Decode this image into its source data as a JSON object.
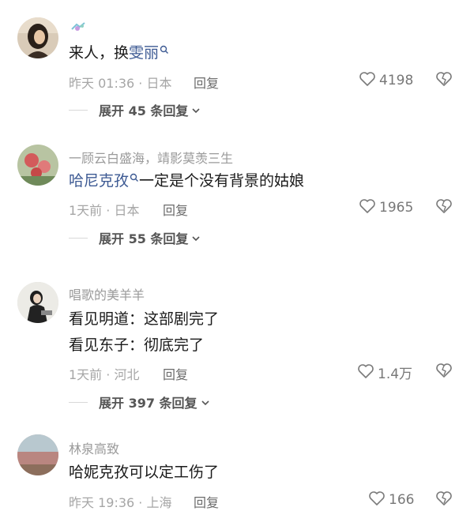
{
  "comments": [
    {
      "username": "",
      "avatar": "avatar-woman-dark-hair",
      "badge": "badge-icon",
      "mention": "雯丽",
      "text_before": "来人，换",
      "text_after": "",
      "meta": "昨天 01:36 · 日本",
      "reply": "回复",
      "likes": "4198",
      "expand": "展开 45 条回复"
    },
    {
      "username": "一顾云白盛海，靖影莫羡三生",
      "avatar": "avatar-flowers",
      "mention": "哈尼克孜",
      "text_before": "",
      "text_after": "一定是个没有背景的姑娘",
      "meta": "1天前 · 日本",
      "reply": "回复",
      "likes": "1965",
      "expand": "展开 55 条回复"
    },
    {
      "username": "唱歌的美羊羊",
      "avatar": "avatar-seated-figure",
      "lines": [
        "看见明道：这部剧完了",
        "看见东子：彻底完了"
      ],
      "meta": "1天前 · 河北",
      "reply": "回复",
      "likes": "1.4万",
      "expand": "展开 397 条回复"
    },
    {
      "username": "林泉高致",
      "avatar": "avatar-landscape",
      "text": "哈妮克孜可以定工伤了",
      "meta": "昨天 19:36 · 上海",
      "reply": "回复",
      "likes": "166"
    }
  ],
  "colors": {
    "mention": "#3d5a93",
    "meta": "#a6a6a6",
    "icon": "#7a7a7a"
  }
}
